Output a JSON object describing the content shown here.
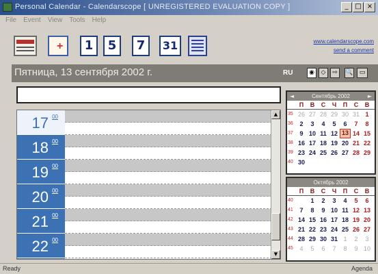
{
  "window": {
    "title": "Personal Calendar - Calendarscope [ UNREGISTERED EVALUATION COPY ]",
    "btn_min": "_",
    "btn_max": "□",
    "btn_close": "×"
  },
  "menu": [
    "File",
    "Event",
    "View",
    "Tools",
    "Help"
  ],
  "toolbar": {
    "day_view_label": "1",
    "week5_view_label": "5",
    "week7_view_label": "7",
    "month_view_label": "31",
    "link_site": "www.calendarscope.com",
    "link_comment": "send a comment"
  },
  "datebar": {
    "date": "Пятница, 13 сентября 2002 г.",
    "lang": "RU",
    "ctl_today": "◉",
    "ctl_prev": "◇",
    "ctl_next": "⇨",
    "ctl_find": "🔍",
    "ctl_view": "▭"
  },
  "schedule": {
    "minutes": "00",
    "hours": [
      "17",
      "18",
      "19",
      "20",
      "21",
      "22"
    ],
    "scroll_up": "▲",
    "scroll_down": "▼"
  },
  "calendars": {
    "weekday_headers": [
      "П",
      "В",
      "С",
      "Ч",
      "П",
      "С",
      "В"
    ],
    "september": {
      "header": "Сентябрь 2002",
      "prev": "◄",
      "next": "►",
      "weeks": [
        {
          "wk": "35",
          "days": [
            "26",
            "27",
            "28",
            "29",
            "30",
            "31",
            "1"
          ]
        },
        {
          "wk": "36",
          "days": [
            "2",
            "3",
            "4",
            "5",
            "6",
            "7",
            "8"
          ]
        },
        {
          "wk": "37",
          "days": [
            "9",
            "10",
            "11",
            "12",
            "13",
            "14",
            "15"
          ]
        },
        {
          "wk": "38",
          "days": [
            "16",
            "17",
            "18",
            "19",
            "20",
            "21",
            "22"
          ]
        },
        {
          "wk": "39",
          "days": [
            "23",
            "24",
            "25",
            "26",
            "27",
            "28",
            "29"
          ]
        },
        {
          "wk": "40",
          "days": [
            "30",
            "",
            "",
            "",
            "",
            "",
            ""
          ]
        }
      ],
      "selected": "13"
    },
    "october": {
      "header": "Октябрь 2002",
      "weeks": [
        {
          "wk": "40",
          "days": [
            "",
            "1",
            "2",
            "3",
            "4",
            "5",
            "6"
          ]
        },
        {
          "wk": "41",
          "days": [
            "7",
            "8",
            "9",
            "10",
            "11",
            "12",
            "13"
          ]
        },
        {
          "wk": "42",
          "days": [
            "14",
            "15",
            "16",
            "17",
            "18",
            "19",
            "20"
          ]
        },
        {
          "wk": "43",
          "days": [
            "21",
            "22",
            "23",
            "24",
            "25",
            "26",
            "27"
          ]
        },
        {
          "wk": "44",
          "days": [
            "28",
            "29",
            "30",
            "31",
            "1",
            "2",
            "3"
          ]
        },
        {
          "wk": "45",
          "days": [
            "4",
            "5",
            "6",
            "7",
            "8",
            "9",
            "10"
          ]
        }
      ]
    }
  },
  "status": {
    "left": "Ready",
    "right": "Agenda"
  },
  "colors": {
    "hour_column": "#3c72b4",
    "date_bar": "#7f7c76",
    "selected_day": "#c63323"
  }
}
